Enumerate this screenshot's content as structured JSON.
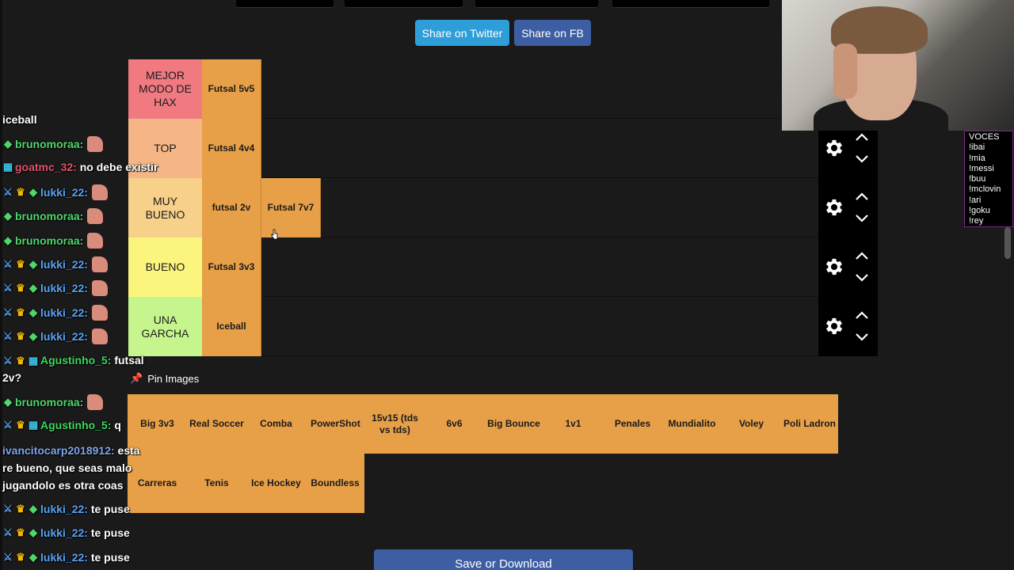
{
  "share": {
    "twitter_label": "Share on Twitter",
    "fb_label": "Share on FB"
  },
  "tiers": [
    {
      "label": "MEJOR MODO DE HAX",
      "color": "#f07a80",
      "items": [
        "Futsal 5v5"
      ]
    },
    {
      "label": "TOP",
      "color": "#f5b585",
      "items": [
        "Futsal 4v4"
      ]
    },
    {
      "label": "MUY BUENO",
      "color": "#f7d08a",
      "items": [
        "futsal 2v",
        "Futsal 7v7"
      ]
    },
    {
      "label": "BUENO",
      "color": "#fbf57e",
      "items": [
        "Futsal 3v3"
      ]
    },
    {
      "label": "UNA GARCHA",
      "color": "#c6f58d",
      "items": [
        "Iceball"
      ]
    }
  ],
  "pin": {
    "label": "Pin Images",
    "icon": "pushpin-icon"
  },
  "pool": [
    "Big 3v3",
    "Real Soccer",
    "Comba",
    "PowerShot",
    "15v15 (tds vs tds)",
    "6v6",
    "Big Bounce",
    "1v1",
    "Penales",
    "Mundialito",
    "Voley",
    "Poli Ladron",
    "Carreras",
    "Tenis",
    "Ice Hockey",
    "Boundless"
  ],
  "save": {
    "label": "Save or Download"
  },
  "item_color": "#e8a048",
  "chat": {
    "lines": [
      {
        "user": "iceball",
        "text": "",
        "color": "#ffffff",
        "badges": [],
        "emote": false
      },
      {
        "user": "brunomoraa:",
        "text": "",
        "color": "#4fd66d",
        "badges": [
          "gem"
        ],
        "emote": true
      },
      {
        "user": "goatmc_32:",
        "text": "no debe existir",
        "color": "#e0566b",
        "badges": [
          "box"
        ],
        "emote": false
      },
      {
        "user": "lukki_22:",
        "text": "",
        "color": "#5aa3f5",
        "badges": [
          "sword",
          "crown",
          "gem"
        ],
        "emote": true
      },
      {
        "user": "brunomoraa:",
        "text": "",
        "color": "#4fd66d",
        "badges": [
          "gem"
        ],
        "emote": true
      },
      {
        "user": "brunomoraa:",
        "text": "",
        "color": "#4fd66d",
        "badges": [
          "gem"
        ],
        "emote": true
      },
      {
        "user": "lukki_22:",
        "text": "",
        "color": "#5aa3f5",
        "badges": [
          "sword",
          "crown",
          "gem"
        ],
        "emote": true
      },
      {
        "user": "lukki_22:",
        "text": "",
        "color": "#5aa3f5",
        "badges": [
          "sword",
          "crown",
          "gem"
        ],
        "emote": true
      },
      {
        "user": "lukki_22:",
        "text": "",
        "color": "#5aa3f5",
        "badges": [
          "sword",
          "crown",
          "gem"
        ],
        "emote": true
      },
      {
        "user": "lukki_22:",
        "text": "",
        "color": "#5aa3f5",
        "badges": [
          "sword",
          "crown",
          "gem"
        ],
        "emote": true
      },
      {
        "user": "Agustinho_5:",
        "text": "futsal 2v?",
        "color": "#3ed660",
        "badges": [
          "sword",
          "crown",
          "box"
        ],
        "emote": false
      },
      {
        "user": "brunomoraa:",
        "text": "",
        "color": "#4fd66d",
        "badges": [
          "gem"
        ],
        "emote": true
      },
      {
        "user": "Agustinho_5:",
        "text": "q",
        "color": "#3ed660",
        "badges": [
          "sword",
          "crown",
          "box"
        ],
        "emote": false
      },
      {
        "user": "ivancitocarp2018912:",
        "text": "esta re bueno, que seas malo jugandolo es otra coas",
        "color": "#7fa6e8",
        "badges": [],
        "emote": false
      },
      {
        "user": "lukki_22:",
        "text": "te puse",
        "color": "#5aa3f5",
        "badges": [
          "sword",
          "crown",
          "gem"
        ],
        "emote": false
      },
      {
        "user": "lukki_22:",
        "text": "te puse",
        "color": "#5aa3f5",
        "badges": [
          "sword",
          "crown",
          "gem"
        ],
        "emote": false
      },
      {
        "user": "lukki_22:",
        "text": "te puse",
        "color": "#5aa3f5",
        "badges": [
          "sword",
          "crown",
          "gem"
        ],
        "emote": false
      }
    ]
  },
  "voices": {
    "title": "VOCES",
    "commands": [
      "!ibai",
      "!mia",
      "!messi",
      "!buu",
      "!mclovin",
      "!ari",
      "!goku",
      "!rey"
    ]
  }
}
